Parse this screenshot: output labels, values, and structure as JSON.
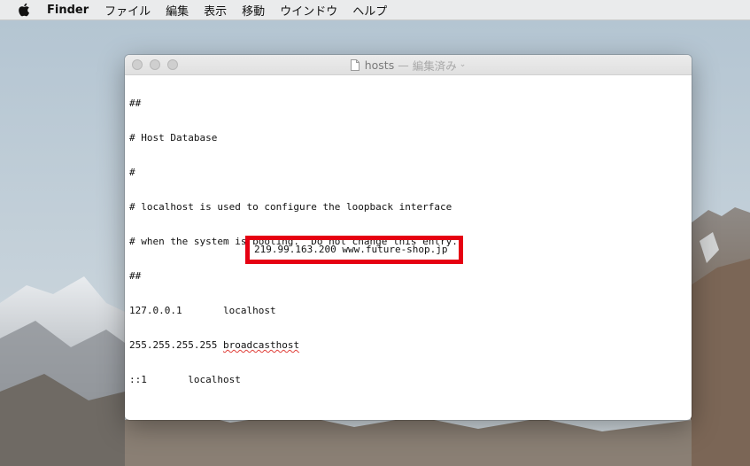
{
  "menubar": {
    "app_name": "Finder",
    "items": [
      "ファイル",
      "編集",
      "表示",
      "移動",
      "ウインドウ",
      "ヘルプ"
    ]
  },
  "window": {
    "filename": "hosts",
    "separator": "—",
    "status": "編集済み",
    "chevron": "⌄"
  },
  "editor": {
    "lines": [
      "##",
      "# Host Database",
      "#",
      "# localhost is used to configure the loopback interface",
      "# when the system is booting.  Do not change this entry.",
      "##",
      "127.0.0.1       localhost",
      "255.255.255.255 ",
      "::1       localhost"
    ],
    "misspelled_word": "broadcasthost",
    "added_entry": "219.99.163.200 www.future-shop.jp"
  },
  "colors": {
    "highlight": "#e60012",
    "spellcheck": "#e0403a"
  }
}
